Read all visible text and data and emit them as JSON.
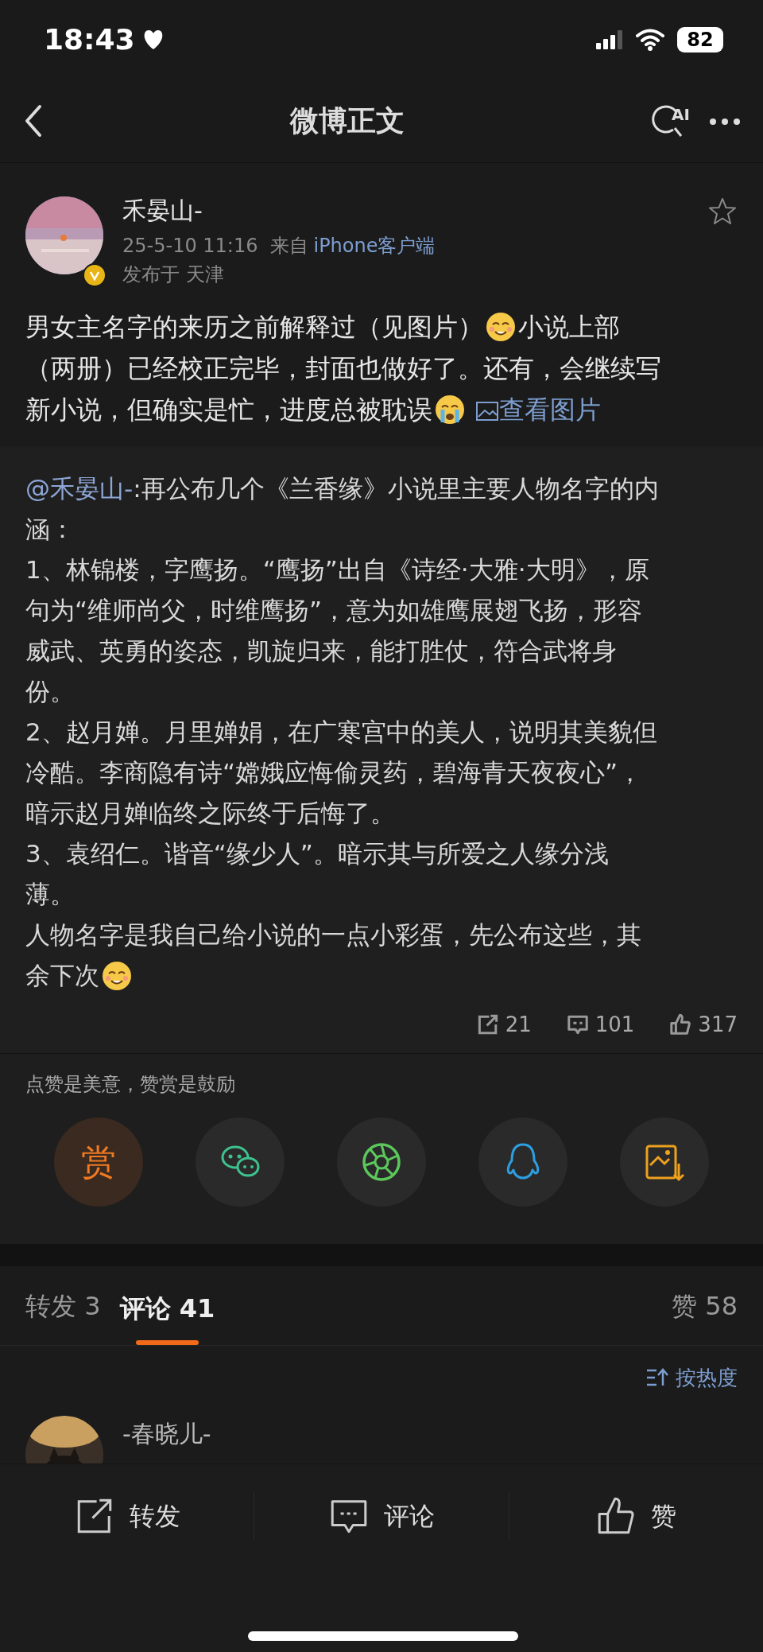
{
  "status_bar": {
    "time": "18:43",
    "battery": "82"
  },
  "nav": {
    "title": "微博正文",
    "ai_label": "AI"
  },
  "post": {
    "author": "禾晏山-",
    "verified": true,
    "time": "25-5-10 11:16",
    "source_prefix": "来自",
    "source": "iPhone客户端",
    "location": "发布于 天津",
    "starred": false,
    "lines": [
      [
        {
          "kind": "text",
          "text": "男女主名字的来历之前解释过（见图片）"
        },
        {
          "kind": "smile_emoji"
        },
        {
          "kind": "text",
          "text": "小说上部"
        }
      ],
      [
        {
          "kind": "text",
          "text": "（两册）已经校正完毕，封面也做好了。还有，会继续写"
        }
      ],
      [
        {
          "kind": "text",
          "text": "新小说，但确实是忙，进度总被耽误"
        },
        {
          "kind": "cry_emoji"
        },
        {
          "kind": "link",
          "text": "查看图片"
        }
      ]
    ]
  },
  "quote": {
    "lines": [
      [
        {
          "kind": "mention",
          "text": "@禾晏山-"
        },
        {
          "kind": "text",
          "text": ":再公布几个《兰香缘》小说里主要人物名字的内"
        }
      ],
      [
        {
          "kind": "text",
          "text": "涵："
        }
      ],
      [
        {
          "kind": "text",
          "text": "1、林锦楼，字鹰扬。“鹰扬”出自《诗经·大雅·大明》，原"
        }
      ],
      [
        {
          "kind": "text",
          "text": "句为“维师尚父，时维鹰扬”，意为如雄鹰展翅飞扬，形容"
        }
      ],
      [
        {
          "kind": "text",
          "text": "威武、英勇的姿态，凯旋归来，能打胜仗，符合武将身"
        }
      ],
      [
        {
          "kind": "text",
          "text": "份。"
        }
      ],
      [
        {
          "kind": "text",
          "text": "2、赵月婵。月里婵娟，在广寒宫中的美人，说明其美貌但"
        }
      ],
      [
        {
          "kind": "text",
          "text": "冷酷。李商隐有诗“嫦娥应悔偷灵药，碧海青天夜夜心”，"
        }
      ],
      [
        {
          "kind": "text",
          "text": "暗示赵月婵临终之际终于后悔了。"
        }
      ],
      [
        {
          "kind": "text",
          "text": "3、袁绍仁。谐音“缘少人”。暗示其与所爱之人缘分浅"
        }
      ],
      [
        {
          "kind": "text",
          "text": "薄。"
        }
      ],
      [
        {
          "kind": "text",
          "text": "人物名字是我自己给小说的一点小彩蛋，先公布这些，其"
        }
      ],
      [
        {
          "kind": "text",
          "text": "余下次"
        },
        {
          "kind": "smile_emoji"
        }
      ]
    ],
    "stats": [
      {
        "kind": "repost",
        "count": "21"
      },
      {
        "kind": "comment",
        "count": "101"
      },
      {
        "kind": "like",
        "count": "317"
      }
    ]
  },
  "reward": {
    "hint": "点赞是美意，赞赏是鼓励",
    "reward_label": "赏",
    "share_targets": [
      {
        "kind": "wechat"
      },
      {
        "kind": "moments"
      },
      {
        "kind": "qq"
      },
      {
        "kind": "save_image"
      }
    ]
  },
  "tabs": [
    {
      "label": "转发 3",
      "selected": false
    },
    {
      "label": "评论 41",
      "selected": true
    }
  ],
  "likes_tab": "赞 58",
  "sort": "按热度",
  "comments": [
    {
      "name": "-春晓儿-"
    }
  ],
  "bottom_bar": [
    {
      "kind": "repost",
      "label": "转发"
    },
    {
      "kind": "comment",
      "label": "评论"
    },
    {
      "kind": "like",
      "label": "赞"
    }
  ]
}
